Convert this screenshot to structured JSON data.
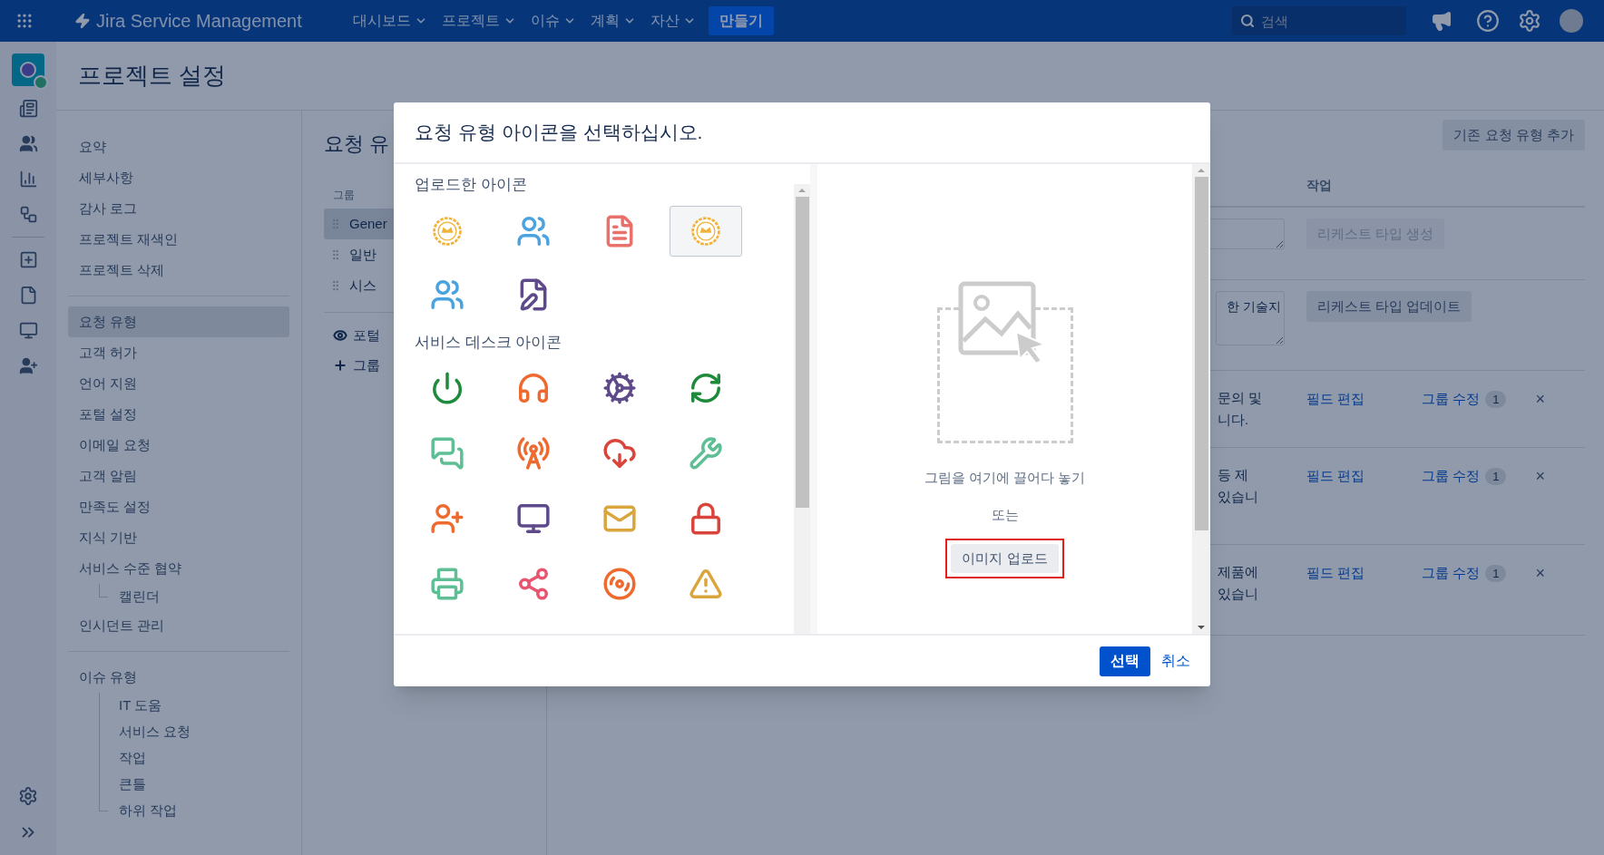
{
  "top_nav": {
    "product": "Jira Service Management",
    "menus": [
      {
        "label": "대시보드"
      },
      {
        "label": "프로젝트"
      },
      {
        "label": "이슈"
      },
      {
        "label": "계획"
      },
      {
        "label": "자산"
      }
    ],
    "create": "만들기",
    "search": {
      "placeholder": "검색"
    }
  },
  "settings": {
    "title": "프로젝트 설정",
    "groups": [
      {
        "items": [
          {
            "label": "요약",
            "selected": false
          },
          {
            "label": "세부사항",
            "selected": false
          },
          {
            "label": "감사 로그",
            "selected": false
          },
          {
            "label": "프로젝트 재색인",
            "selected": false
          },
          {
            "label": "프로젝트 삭제",
            "selected": false
          }
        ]
      },
      {
        "items": [
          {
            "label": "요청 유형",
            "selected": true
          },
          {
            "label": "고객 허가",
            "selected": false
          },
          {
            "label": "언어 지원",
            "selected": false
          },
          {
            "label": "포털 설정",
            "selected": false
          },
          {
            "label": "이메일 요청",
            "selected": false
          },
          {
            "label": "고객 알림",
            "selected": false
          },
          {
            "label": "만족도 설정",
            "selected": false
          },
          {
            "label": "지식 기반",
            "selected": false
          },
          {
            "label": "서비스 수준 협약",
            "selected": false,
            "children": [
              {
                "label": "캘린더",
                "selected": false
              }
            ]
          },
          {
            "label": "인시던트 관리",
            "selected": false
          }
        ]
      },
      {
        "items": [
          {
            "label": "이슈 유형",
            "selected": false,
            "children": [
              {
                "label": "IT 도움",
                "selected": false
              },
              {
                "label": "서비스 요청",
                "selected": false
              },
              {
                "label": "작업",
                "selected": false
              },
              {
                "label": "큰틀",
                "selected": false
              },
              {
                "label": "하위 작업",
                "selected": false
              }
            ]
          }
        ]
      }
    ]
  },
  "request_types": {
    "title": "요청 유",
    "group_header": "그룹",
    "groups": [
      {
        "label": "Gener",
        "selected": true
      },
      {
        "label": "일반",
        "selected": false
      },
      {
        "label": "시스",
        "selected": false
      }
    ],
    "portal_link": "포털",
    "add_group": "그룹"
  },
  "table": {
    "add_button": "기존 요청 유형 추가",
    "action_header": "작업",
    "rows": [
      {
        "kind": "new",
        "action": "리케스트 타입 생성",
        "disabled": true
      },
      {
        "kind": "edit",
        "description": "한 기술지",
        "action": "리케스트 타입 업데이트",
        "disabled": false
      },
      {
        "kind": "item",
        "description": [
          "문의 및",
          "니다."
        ],
        "edit_fields": "필드 편집",
        "edit_groups": "그룹 수정",
        "group_count": "1",
        "remove": "×"
      },
      {
        "kind": "item",
        "description": [
          "등 제",
          "있습니"
        ],
        "edit_fields": "필드 편집",
        "edit_groups": "그룹 수정",
        "group_count": "1",
        "remove": "×"
      },
      {
        "kind": "item",
        "description": [
          "제품에",
          "있습니"
        ],
        "edit_fields": "필드 편집",
        "edit_groups": "그룹 수정",
        "group_count": "1",
        "remove": "×"
      }
    ]
  },
  "dialog": {
    "title": "요청 유형 아이콘을 선택하십시오.",
    "uploaded_label": "업로드한 아이콘",
    "uploaded_icons": [
      {
        "selected": false
      },
      {
        "selected": false
      },
      {
        "selected": false
      },
      {
        "selected": true
      },
      {
        "selected": false
      },
      {
        "selected": false
      }
    ],
    "service_label": "서비스 데스크 아이콘",
    "service_icons": [
      {
        "selected": false
      },
      {
        "selected": false
      },
      {
        "selected": false
      },
      {
        "selected": false
      },
      {
        "selected": false
      },
      {
        "selected": false
      },
      {
        "selected": false
      },
      {
        "selected": false
      },
      {
        "selected": false
      },
      {
        "selected": false
      },
      {
        "selected": false
      },
      {
        "selected": false
      },
      {
        "selected": false
      },
      {
        "selected": false
      },
      {
        "selected": false
      },
      {
        "selected": false
      }
    ],
    "drop_text": "그림을 여기에 끌어다 놓기",
    "or_text": "또는",
    "upload_button": "이미지 업로드",
    "select_button": "선택",
    "cancel_link": "취소"
  }
}
